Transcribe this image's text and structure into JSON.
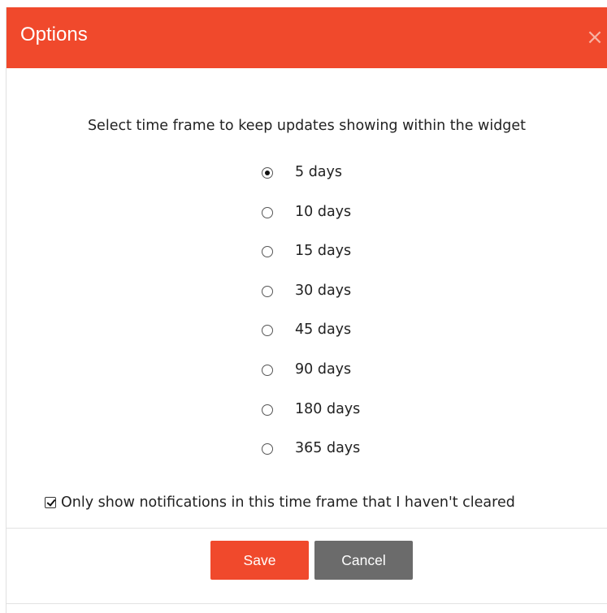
{
  "dialog": {
    "title": "Options",
    "close_symbol": "×",
    "prompt": "Select time frame to keep updates showing within the widget",
    "options": [
      {
        "label": "5 days",
        "checked": true
      },
      {
        "label": "10 days",
        "checked": false
      },
      {
        "label": "15 days",
        "checked": false
      },
      {
        "label": "30 days",
        "checked": false
      },
      {
        "label": "45 days",
        "checked": false
      },
      {
        "label": "90 days",
        "checked": false
      },
      {
        "label": "180 days",
        "checked": false
      },
      {
        "label": "365 days",
        "checked": false
      }
    ],
    "checkbox": {
      "label": "Only show notifications in this time frame that I haven't cleared",
      "checked": true
    },
    "save_label": "Save",
    "cancel_label": "Cancel"
  },
  "colors": {
    "header": "#f0492c",
    "save_button": "#f0492c",
    "cancel_button": "#6b6b6b"
  },
  "icons": {
    "close": "close-icon",
    "radio_checked": "radio-checked-icon",
    "radio_unchecked": "radio-unchecked-icon",
    "checkbox_checked": "checkbox-checked-icon"
  }
}
